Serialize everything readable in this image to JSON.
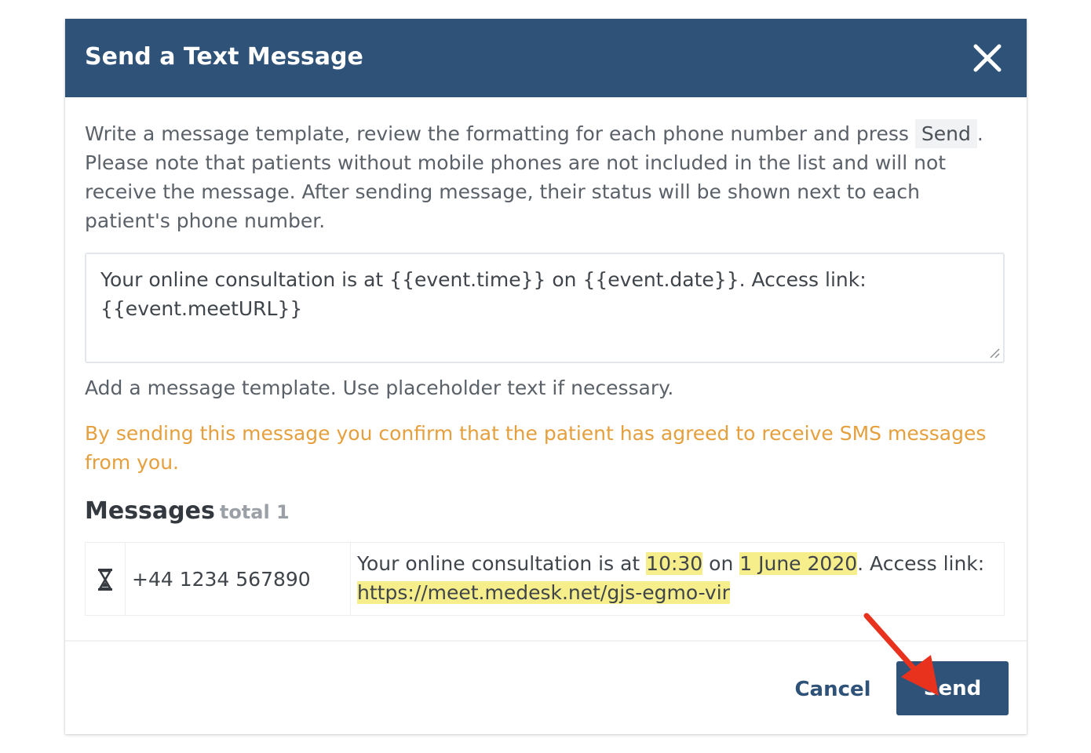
{
  "dialog": {
    "title": "Send a Text Message",
    "close_icon": "close-icon"
  },
  "instructions": {
    "text_before": "Write a message template, review the formatting for each phone number and press ",
    "send_chip": "Send",
    "text_after": ". Please note that patients without mobile phones are not included in the list and will not receive the message. After sending message, their status will be shown next to each patient's phone number."
  },
  "template": {
    "value": "Your online consultation is at {{event.time}} on {{event.date}}. Access link: {{event.meetURL}}",
    "help_text": "Add a message template. Use placeholder text if necessary."
  },
  "warning": {
    "text": "By sending this message you confirm that the patient has agreed to receive SMS messages from you.",
    "color": "#e59f3c"
  },
  "messages": {
    "title": "Messages",
    "total_label": "total 1",
    "rows": [
      {
        "status_icon": "hourglass-icon",
        "phone": "+44 1234 567890",
        "message": {
          "part1": "Your online consultation is at ",
          "time": "10:30",
          "part2": " on ",
          "date": "1 June 2020",
          "part3": ". Access link: ",
          "url": "https://meet.medesk.net/gjs-egmo-vir"
        }
      }
    ]
  },
  "footer": {
    "cancel_label": "Cancel",
    "send_label": "Send"
  },
  "colors": {
    "header": "#2f5279",
    "primary_button": "#2f5279",
    "highlight": "#f6ee8a",
    "annotation_arrow": "#e8321e"
  }
}
